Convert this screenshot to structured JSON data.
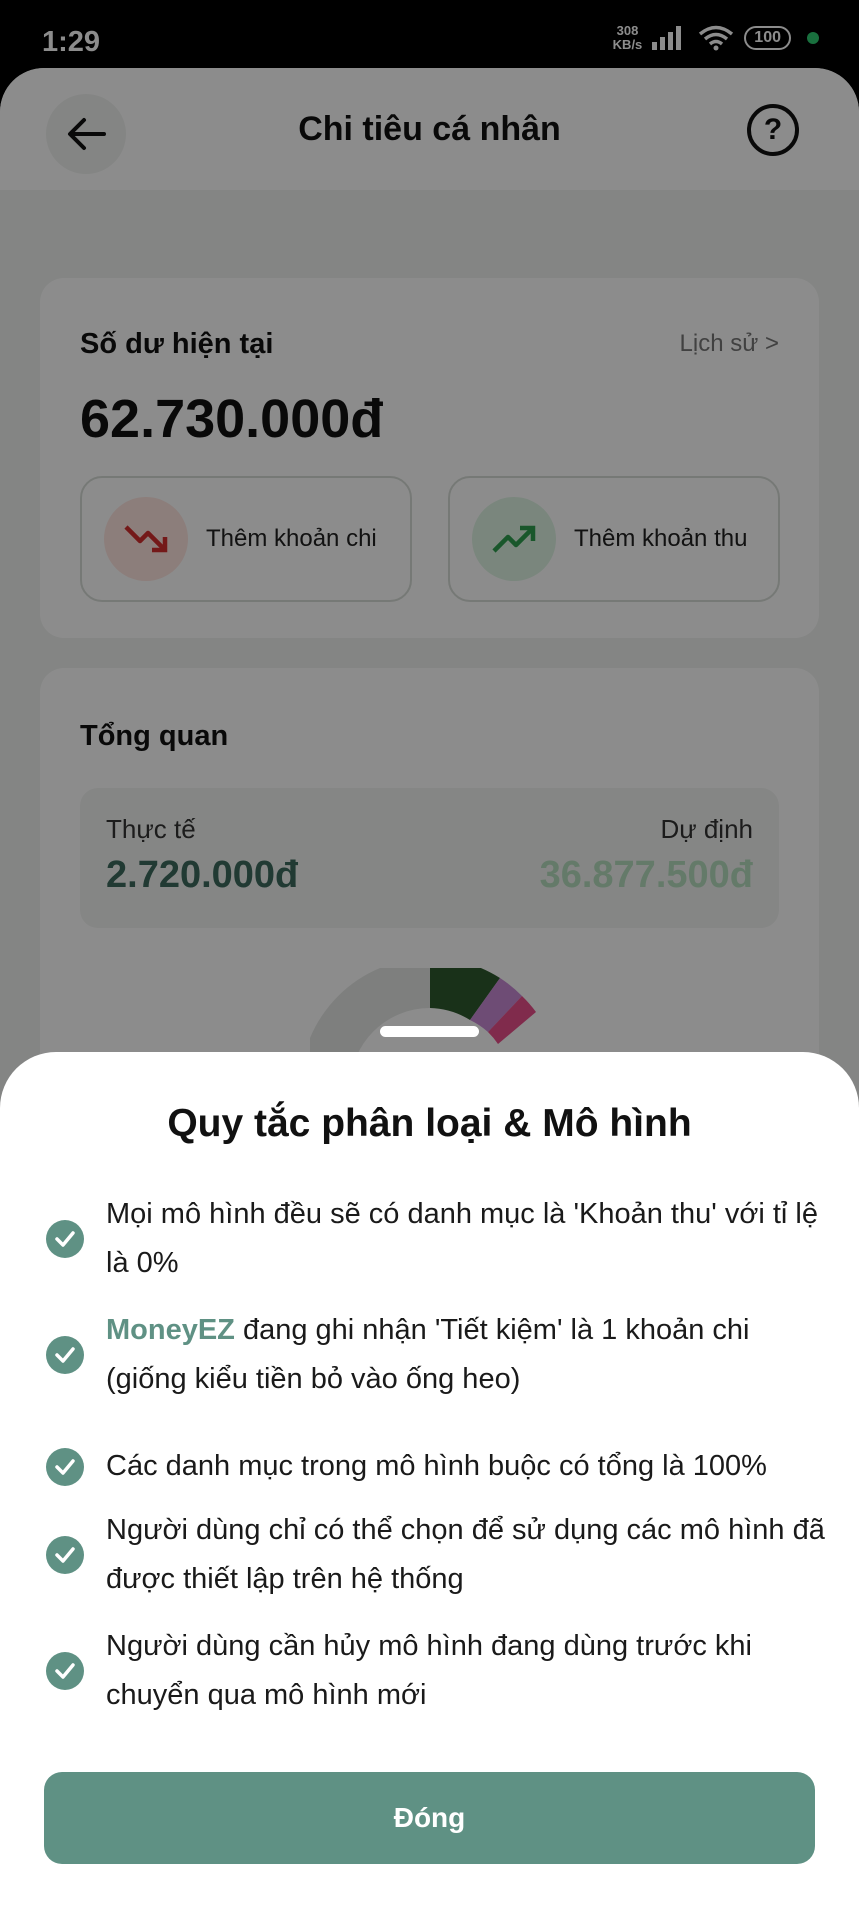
{
  "status_bar": {
    "time": "1:29",
    "speed_value": "308",
    "speed_unit": "KB/s",
    "battery": "100"
  },
  "header": {
    "title": "Chi tiêu cá nhân",
    "help_symbol": "?"
  },
  "balance": {
    "label": "Số dư hiện tại",
    "history_link": "Lịch sử  >",
    "amount": "62.730.000đ",
    "add_expense_label": "Thêm khoản chi",
    "add_income_label": "Thêm khoản thu"
  },
  "overview": {
    "title": "Tổng quan",
    "actual_label": "Thực tế",
    "actual_value": "2.720.000đ",
    "plan_label": "Dự định",
    "plan_value": "36.877.500đ"
  },
  "sheet": {
    "title": "Quy tắc phân loại & Mô hình",
    "rules": [
      {
        "text": "Mọi mô hình đều sẽ có danh mục là 'Khoản thu' với tỉ lệ là 0%"
      },
      {
        "brand": "MoneyEZ",
        "text": " đang ghi nhận 'Tiết kiệm' là 1 khoản chi (giống kiểu tiền bỏ vào ống heo)"
      },
      {
        "text": "Các danh mục trong mô hình buộc có tổng là 100%"
      },
      {
        "text": "Người dùng chỉ có thể chọn để sử dụng các mô hình đã được thiết lập trên hệ thống"
      },
      {
        "text": "Người dùng cần hủy mô hình đang dùng trước khi chuyển qua mô hình mới"
      }
    ],
    "close_label": "Đóng"
  },
  "colors": {
    "accent": "#5f9184",
    "actual_value": "#3d6a5e",
    "plan_value": "#b7dfc0",
    "expense_arrow": "#d32f2f",
    "income_arrow": "#2e9e4f"
  },
  "icons": {
    "back": "arrow-left-icon",
    "help": "question-circle-icon",
    "expense": "trend-down-icon",
    "income": "trend-up-icon",
    "check": "check-circle-icon"
  }
}
